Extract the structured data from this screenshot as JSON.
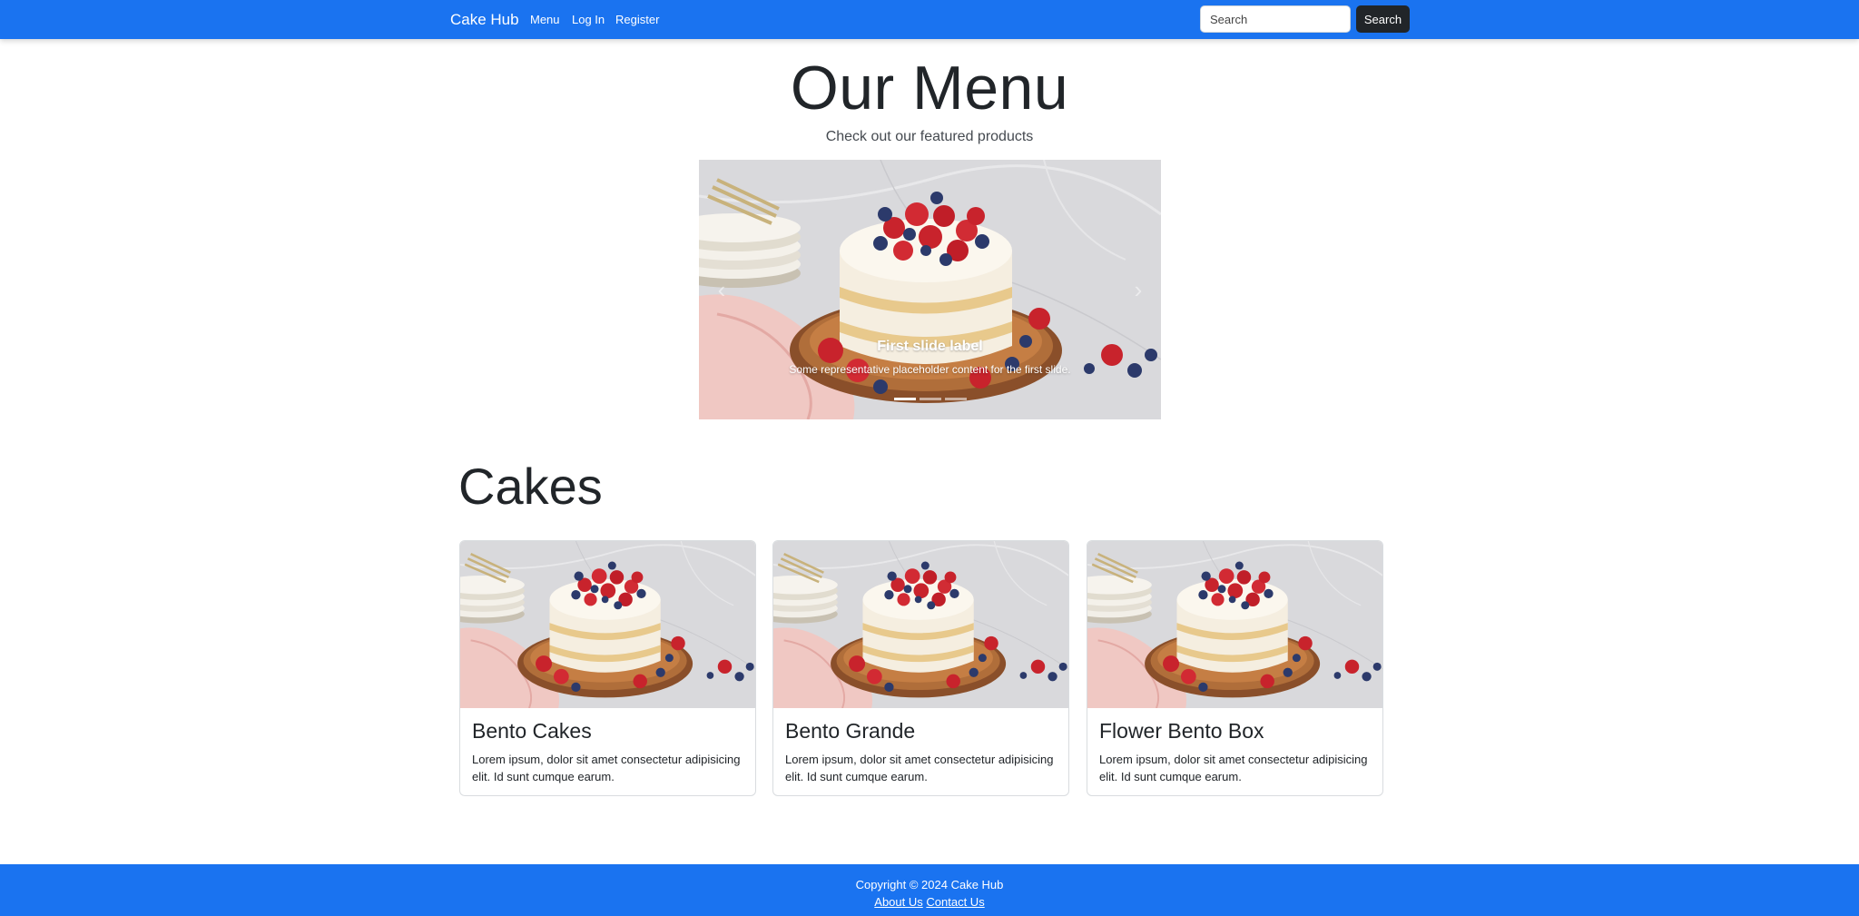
{
  "nav": {
    "brand": "Cake Hub",
    "links": [
      "Menu",
      "Log In",
      "Register"
    ],
    "search_placeholder": "Search",
    "search_button": "Search"
  },
  "hero": {
    "title": "Our Menu",
    "subtitle": "Check out our featured products"
  },
  "carousel": {
    "caption_title": "First slide label",
    "caption_text": "Some representative placeholder content for the first slide.",
    "slides": 3,
    "active_slide": 1
  },
  "section": {
    "title": "Cakes"
  },
  "cards": [
    {
      "title": "Bento Cakes",
      "text": "Lorem ipsum, dolor sit amet consectetur adipisicing elit. Id sunt cumque earum."
    },
    {
      "title": "Bento Grande",
      "text": "Lorem ipsum, dolor sit amet consectetur adipisicing elit. Id sunt cumque earum."
    },
    {
      "title": "Flower Bento Box",
      "text": "Lorem ipsum, dolor sit amet consectetur adipisicing elit. Id sunt cumque earum."
    }
  ],
  "footer": {
    "copyright": "Copyright © 2024 Cake Hub",
    "links": [
      "About Us",
      "Contact Us"
    ]
  },
  "colors": {
    "primary": "#1a73f0",
    "dark": "#212529"
  }
}
